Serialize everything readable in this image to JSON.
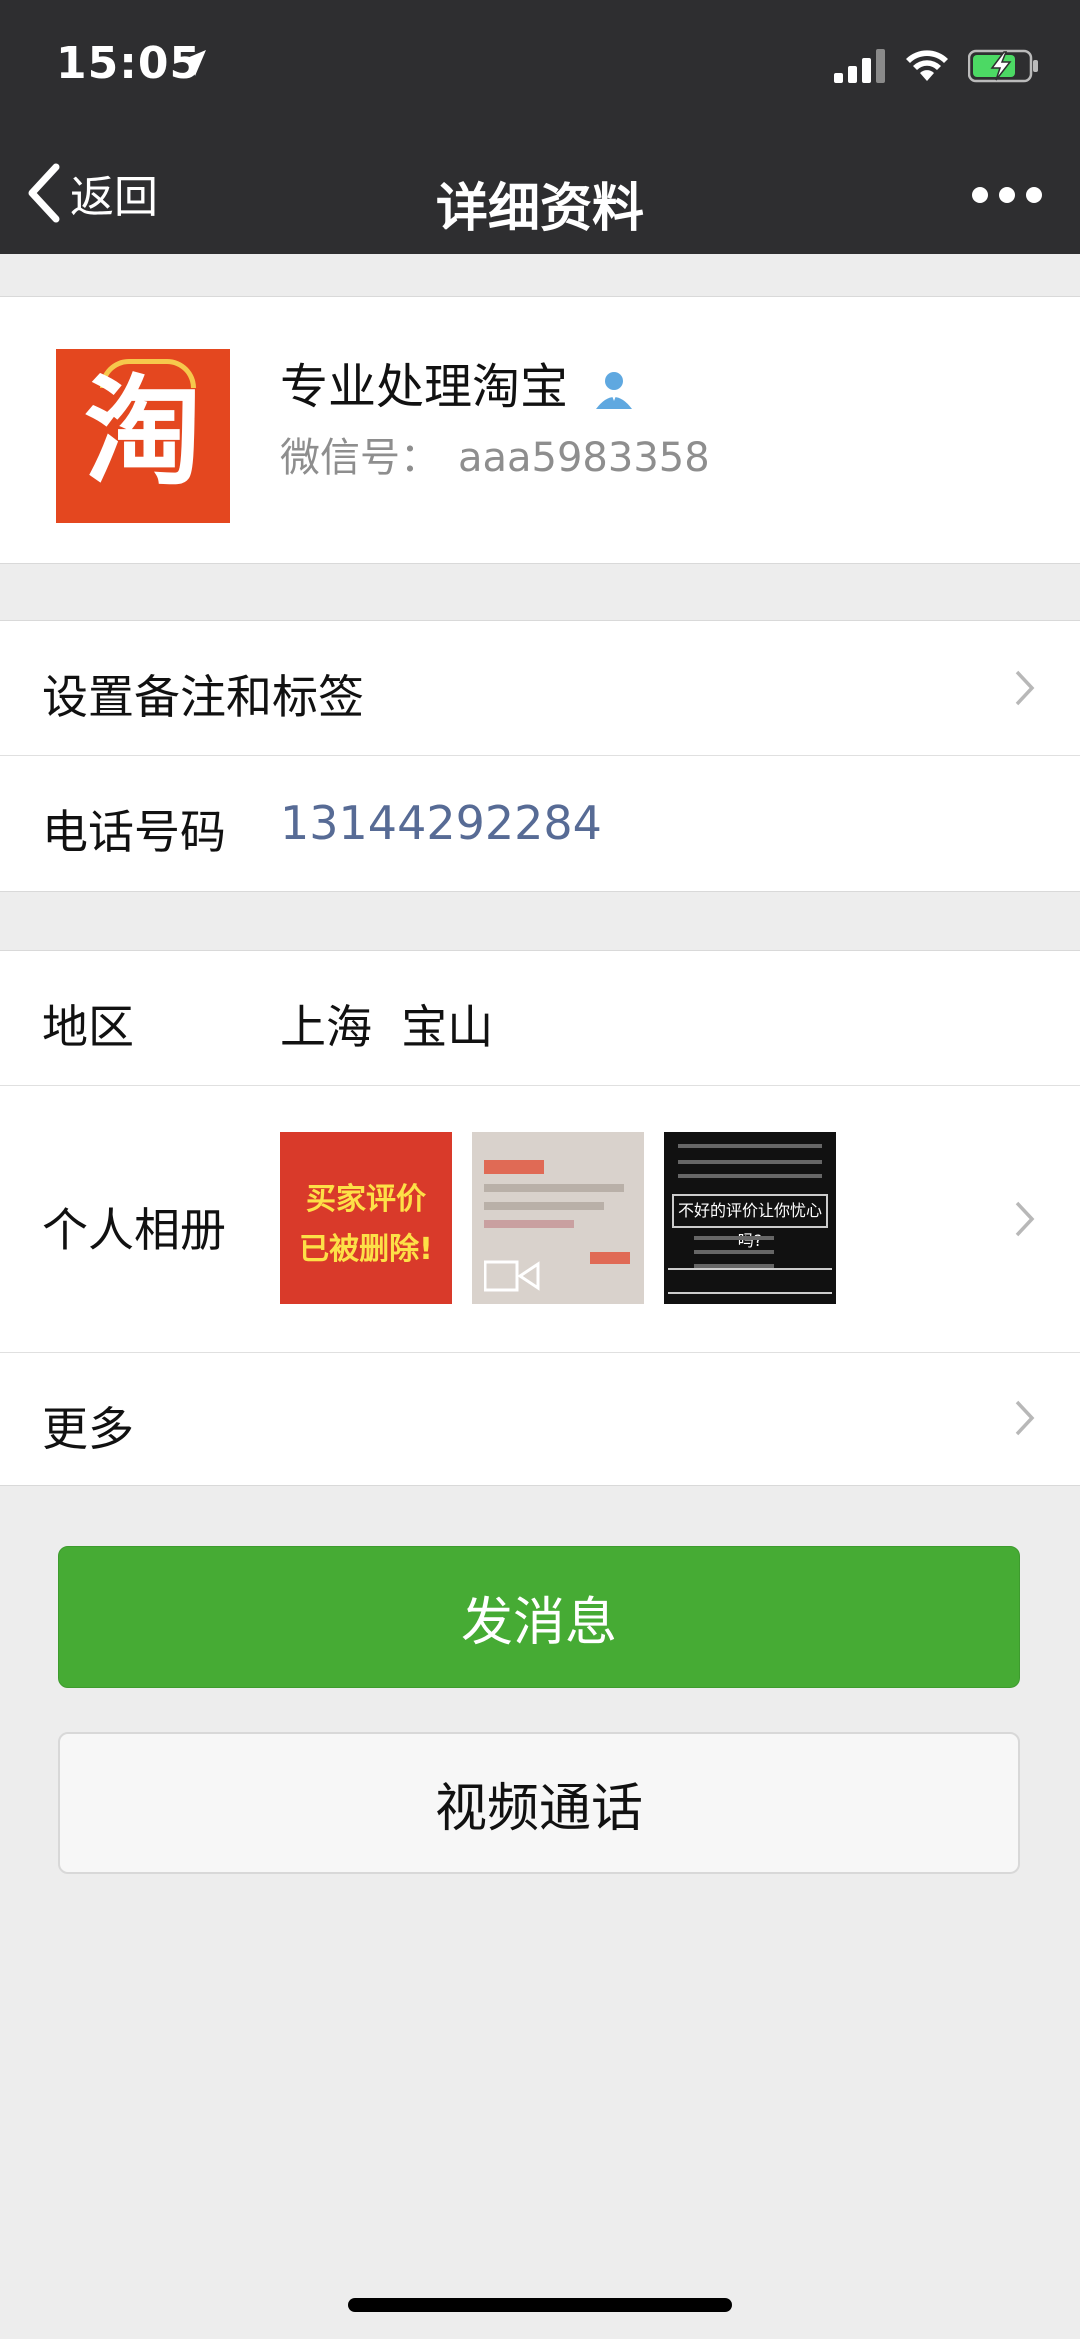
{
  "status_bar": {
    "time": "15:05",
    "icons": [
      "location-arrow-icon",
      "signal-icon",
      "wifi-icon",
      "battery-charging-icon"
    ]
  },
  "nav": {
    "back_label": "返回",
    "title": "详细资料",
    "more_icon": "more-dots-icon"
  },
  "profile": {
    "avatar_char": "淘",
    "name": "专业处理淘宝",
    "wechat_id_label": "微信号：",
    "wechat_id": "aaa5983358"
  },
  "rows": {
    "remark": {
      "label": "设置备注和标签"
    },
    "phone": {
      "label": "电话号码",
      "value": "13144292284"
    },
    "region": {
      "label": "地区",
      "value": "上海  宝山"
    },
    "album": {
      "label": "个人相册",
      "thumb1_line1": "买家评价",
      "thumb1_line2": "已被删除!",
      "thumb3_text": "不好的评价让你忧心吗?"
    },
    "more": {
      "label": "更多"
    }
  },
  "buttons": {
    "send_message": "发消息",
    "video_call": "视频通话"
  },
  "colors": {
    "nav_bg": "#2E2E30",
    "page_bg": "#EDEDED",
    "primary_green": "#46AB34",
    "link_blue": "#576B95"
  }
}
